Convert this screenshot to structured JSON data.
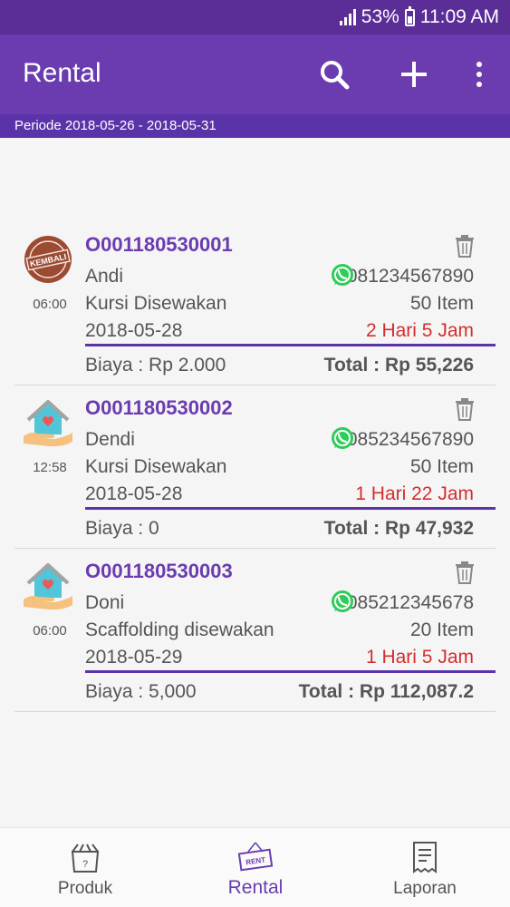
{
  "status": {
    "battery": "53%",
    "time": "11:09 AM"
  },
  "app": {
    "title": "Rental"
  },
  "period": "Periode 2018-05-26 - 2018-05-31",
  "rentals": [
    {
      "code": "O001180530001",
      "time": "06:00",
      "name": "Andi",
      "phone": "081234567890",
      "item": "Kursi Disewakan",
      "qty": "50 Item",
      "date": "2018-05-28",
      "duration": "2 Hari 5 Jam",
      "fee": "Biaya : Rp 2.000",
      "total": "Total : Rp 55,226",
      "icon": "kembali-stamp-icon",
      "stamp_text": "KEMBALI"
    },
    {
      "code": "O001180530002",
      "time": "12:58",
      "name": "Dendi",
      "phone": "085234567890",
      "item": "Kursi Disewakan",
      "qty": "50 Item",
      "date": "2018-05-28",
      "duration": "1 Hari 22 Jam",
      "fee": "Biaya : 0",
      "total": "Total : Rp 47,932",
      "icon": "house-in-hand-icon"
    },
    {
      "code": "O001180530003",
      "time": "06:00",
      "name": "Doni",
      "phone": "085212345678",
      "item": "Scaffolding disewakan",
      "qty": "20 Item",
      "date": "2018-05-29",
      "duration": "1 Hari 5 Jam",
      "fee": "Biaya : 5,000",
      "total": "Total : Rp 112,087.2",
      "icon": "house-in-hand-icon"
    }
  ],
  "nav": [
    {
      "label": "Produk",
      "icon": "produk-box-icon"
    },
    {
      "label": "Rental",
      "icon": "rent-sign-icon",
      "active": true,
      "sign_text": "RENT"
    },
    {
      "label": "Laporan",
      "icon": "receipt-icon"
    }
  ]
}
